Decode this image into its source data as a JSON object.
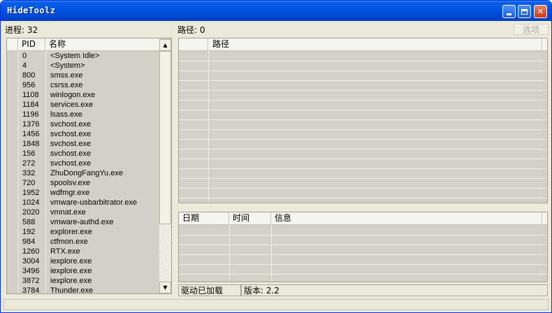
{
  "window": {
    "title": "HideToolz"
  },
  "left_panel": {
    "label": "进程: 32",
    "columns": [
      "PID",
      "名称"
    ],
    "rows": [
      {
        "pid": "0",
        "name": "<System Idle>"
      },
      {
        "pid": "4",
        "name": "<System>"
      },
      {
        "pid": "800",
        "name": "smss.exe"
      },
      {
        "pid": "956",
        "name": "csrss.exe"
      },
      {
        "pid": "1108",
        "name": "winlogon.exe"
      },
      {
        "pid": "1184",
        "name": "services.exe"
      },
      {
        "pid": "1196",
        "name": "lsass.exe"
      },
      {
        "pid": "1376",
        "name": "svchost.exe"
      },
      {
        "pid": "1456",
        "name": "svchost.exe"
      },
      {
        "pid": "1848",
        "name": "svchost.exe"
      },
      {
        "pid": "156",
        "name": "svchost.exe"
      },
      {
        "pid": "272",
        "name": "svchost.exe"
      },
      {
        "pid": "332",
        "name": "ZhuDongFangYu.exe"
      },
      {
        "pid": "720",
        "name": "spoolsv.exe"
      },
      {
        "pid": "1952",
        "name": "wdfmgr.exe"
      },
      {
        "pid": "1024",
        "name": "vmware-usbarbitrator.exe"
      },
      {
        "pid": "2020",
        "name": "vmnat.exe"
      },
      {
        "pid": "588",
        "name": "vmware-authd.exe"
      },
      {
        "pid": "192",
        "name": "explorer.exe"
      },
      {
        "pid": "984",
        "name": "ctfmon.exe"
      },
      {
        "pid": "1260",
        "name": "RTX.exe"
      },
      {
        "pid": "3004",
        "name": "iexplore.exe"
      },
      {
        "pid": "3496",
        "name": "iexplore.exe"
      },
      {
        "pid": "3872",
        "name": "iexplore.exe"
      },
      {
        "pid": "3784",
        "name": "Thunder.exe"
      }
    ]
  },
  "right_panel": {
    "label": "路径: 0",
    "options_button": "选项",
    "path_columns": [
      "",
      "路径"
    ],
    "log_columns": [
      "日期",
      "时间",
      "信息"
    ]
  },
  "status": {
    "driver": "驱动已加载",
    "version": "版本: 2.2"
  },
  "icons": {
    "minimize": "minimize-icon",
    "maximize": "maximize-icon",
    "close": "close-icon",
    "scroll_up": "arrow-up-icon",
    "scroll_down": "arrow-down-icon"
  },
  "colors": {
    "titlebar": "#0055e5",
    "close_button": "#c63b17",
    "list_background": "#d4d0c8"
  }
}
